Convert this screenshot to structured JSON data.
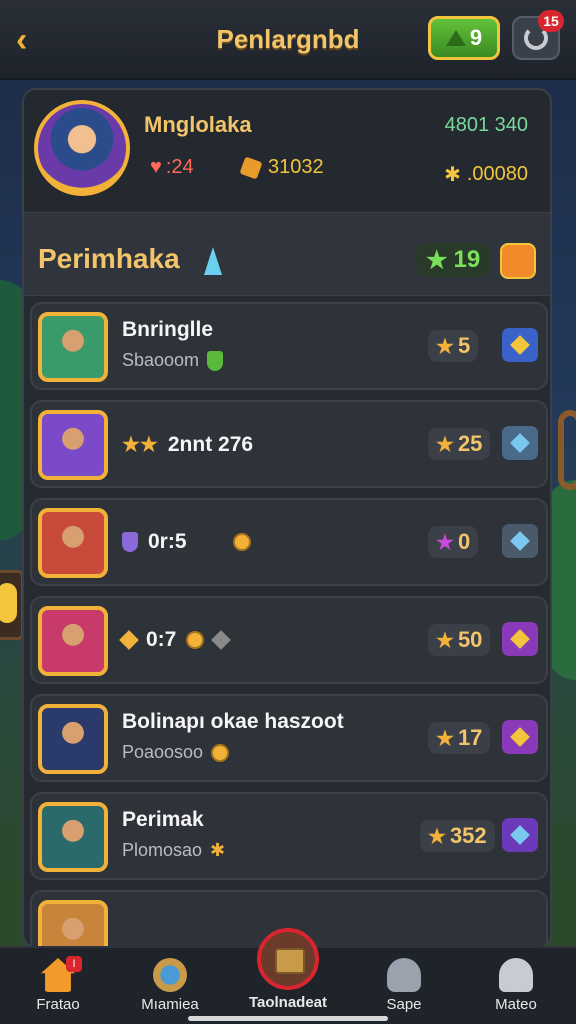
{
  "header": {
    "title": "Penlargnbd",
    "gems": "9",
    "notification_badge": "15"
  },
  "profile": {
    "name": "Mnglolaka",
    "score": "4801 340",
    "hearts": ":24",
    "gold": "31032",
    "energy": ".00080"
  },
  "section": {
    "title": "Perimhaka",
    "stars": "19"
  },
  "rows": [
    {
      "line1": "Bnringlle",
      "line2": "Sbaooom",
      "score": "5",
      "btn_color": "#3a62c8",
      "diamond_color": "#f2c53d",
      "avatar": "#3a9a6a"
    },
    {
      "inline_text": "2nnt 276",
      "score": "25",
      "btn_color": "#4a6a8a",
      "diamond_color": "#7ac8f0",
      "avatar": "#7a4ac8"
    },
    {
      "inline_text": "0r:5",
      "score": "0",
      "btn_color": "#4a5a6a",
      "diamond_color": "#7ac8f0",
      "avatar": "#c84a3a",
      "score_icon": "purple"
    },
    {
      "inline_text": "0:7",
      "score": "50",
      "btn_color": "#8a3ab8",
      "diamond_color": "#f2c53d",
      "avatar": "#c83a6a"
    },
    {
      "line1": "Bolinapı okae haszoot",
      "line2": "Poaoosoo",
      "score": "17",
      "btn_color": "#8a3ab8",
      "diamond_color": "#f2c53d",
      "avatar": "#2a3a6a"
    },
    {
      "line1": "Perimak",
      "line2": "Plomosao",
      "score": "352",
      "btn_color": "#6a3ab8",
      "diamond_color": "#7ac8f0",
      "avatar": "#2a6a6a"
    }
  ],
  "nav": [
    {
      "label": "Fratao",
      "badge": "I"
    },
    {
      "label": "Mıamiea"
    },
    {
      "label": "Taolnadeat"
    },
    {
      "label": "Sape"
    },
    {
      "label": "Mateo"
    }
  ]
}
